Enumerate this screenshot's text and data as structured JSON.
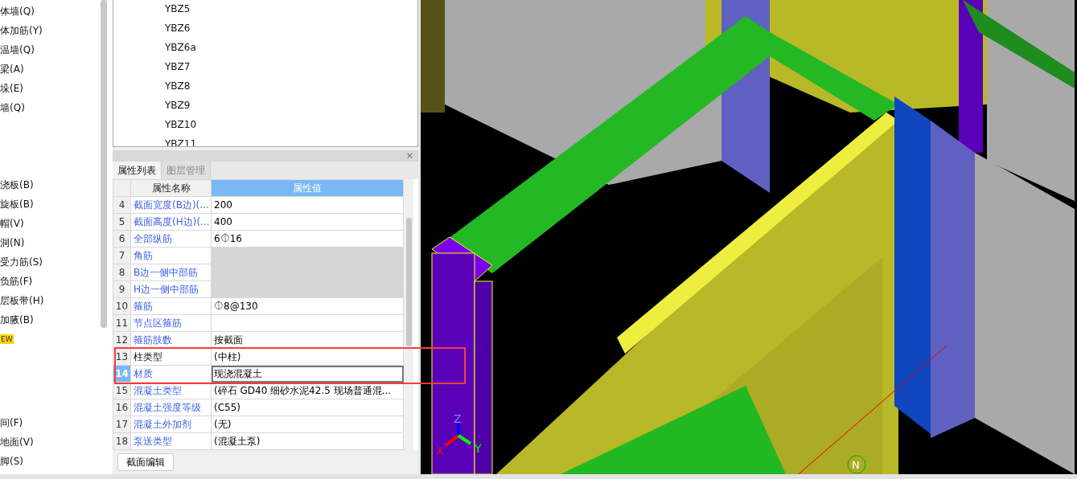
{
  "sidebar": {
    "items": [
      {
        "label": "体墙(Q)"
      },
      {
        "label": "体加筋(Y)"
      },
      {
        "label": "温墙(Q)"
      },
      {
        "label": "梁(A)"
      },
      {
        "label": "垛(E)"
      },
      {
        "label": "墙(Q)"
      }
    ],
    "items_mid": [
      {
        "label": "浇板(B)"
      },
      {
        "label": "旋板(B)"
      },
      {
        "label": "帽(V)"
      },
      {
        "label": "洞(N)"
      },
      {
        "label": "受力筋(S)"
      },
      {
        "label": "负筋(F)"
      },
      {
        "label": "层板带(H)"
      },
      {
        "label": "加腋(B)"
      }
    ],
    "badge": "EW",
    "items_lower": [
      {
        "label": "间(F)"
      },
      {
        "label": "地面(V)"
      },
      {
        "label": "脚(S)"
      }
    ]
  },
  "component_list": {
    "items": [
      {
        "label": "YBZ5"
      },
      {
        "label": "YBZ6"
      },
      {
        "label": "YBZ6a"
      },
      {
        "label": "YBZ7"
      },
      {
        "label": "YBZ8"
      },
      {
        "label": "YBZ9"
      },
      {
        "label": "YBZ10"
      },
      {
        "label": "YBZ11"
      }
    ]
  },
  "properties": {
    "close": "×",
    "tabs": [
      {
        "label": "属性列表",
        "selected": true
      },
      {
        "label": "图层管理",
        "selected": false
      }
    ],
    "columns": [
      "属性名称",
      "属性值"
    ],
    "rows": [
      {
        "num": "4",
        "name": "截面宽度(B边)(...",
        "value": "200",
        "public": true,
        "disabled": false,
        "selected": false
      },
      {
        "num": "5",
        "name": "截面高度(H边)(...",
        "value": "400",
        "public": true,
        "disabled": false,
        "selected": false
      },
      {
        "num": "6",
        "name": "全部纵筋",
        "value": "6⏀16",
        "public": true,
        "disabled": false,
        "selected": false
      },
      {
        "num": "7",
        "name": "角筋",
        "value": "",
        "public": true,
        "disabled": true,
        "selected": false
      },
      {
        "num": "8",
        "name": "B边一侧中部筋",
        "value": "",
        "public": true,
        "disabled": true,
        "selected": false
      },
      {
        "num": "9",
        "name": "H边一侧中部筋",
        "value": "",
        "public": true,
        "disabled": true,
        "selected": false
      },
      {
        "num": "10",
        "name": "箍筋",
        "value": "⏀8@130",
        "public": true,
        "disabled": false,
        "selected": false
      },
      {
        "num": "11",
        "name": "节点区箍筋",
        "value": "",
        "public": true,
        "disabled": false,
        "selected": false
      },
      {
        "num": "12",
        "name": "箍筋肢数",
        "value": "按截面",
        "public": true,
        "disabled": false,
        "selected": false
      },
      {
        "num": "13",
        "name": "柱类型",
        "value": "(中柱)",
        "public": false,
        "disabled": false,
        "selected": false
      },
      {
        "num": "14",
        "name": "材质",
        "value": "现浇混凝土",
        "public": true,
        "disabled": false,
        "selected": true
      },
      {
        "num": "15",
        "name": "混凝土类型",
        "value": "(碎石 GD40 细砂水泥42.5 现场普通混...",
        "public": true,
        "disabled": false,
        "selected": false
      },
      {
        "num": "16",
        "name": "混凝土强度等级",
        "value": "(C55)",
        "public": true,
        "disabled": false,
        "selected": false
      },
      {
        "num": "17",
        "name": "混凝土外加剂",
        "value": "(无)",
        "public": true,
        "disabled": false,
        "selected": false
      },
      {
        "num": "18",
        "name": "泵送类型",
        "value": "(混凝土泵)",
        "public": true,
        "disabled": false,
        "selected": false
      }
    ],
    "button": "截面编辑"
  },
  "viewport": {
    "axes": [
      "X",
      "Y",
      "Z"
    ],
    "compass": "N"
  }
}
